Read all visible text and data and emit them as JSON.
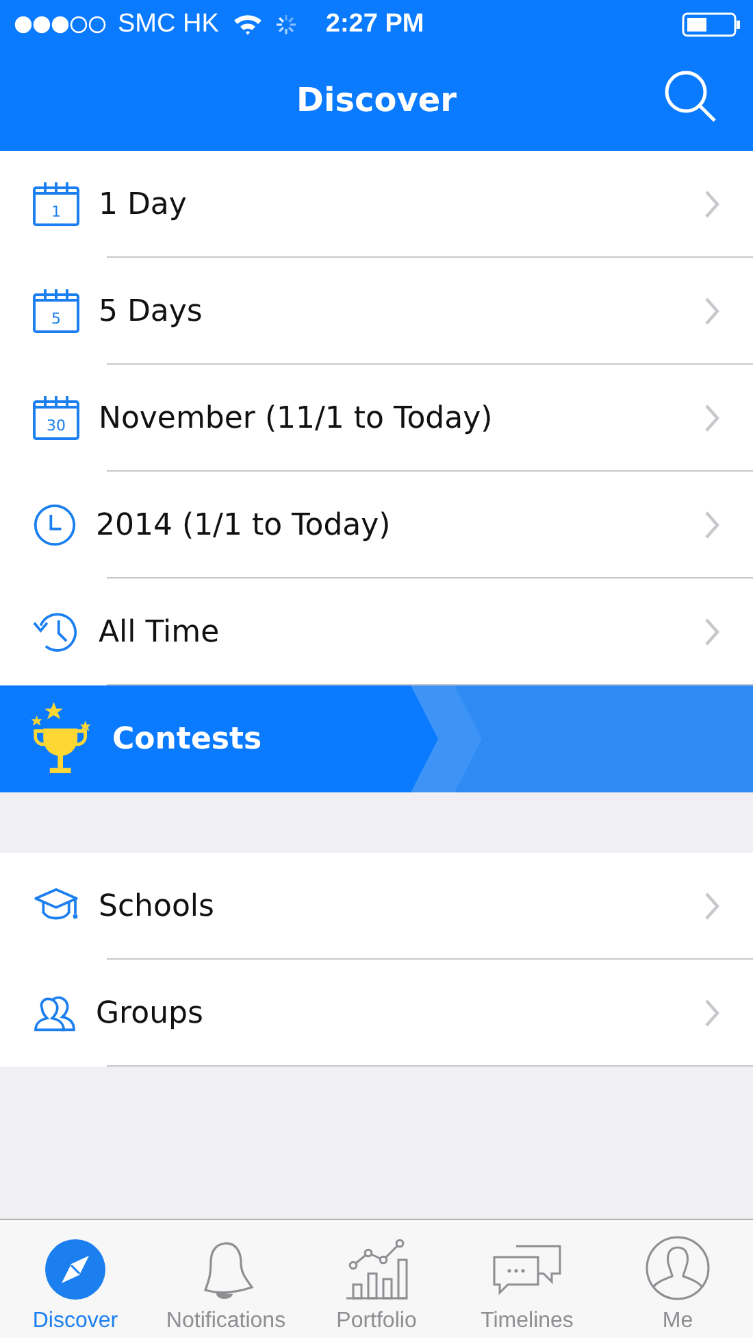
{
  "status_bar": {
    "carrier": "SMC HK",
    "time": "2:27 PM"
  },
  "nav": {
    "title": "Discover"
  },
  "periods": [
    {
      "kind": "calendar",
      "icon_text": "1",
      "label": "1 Day"
    },
    {
      "kind": "calendar",
      "icon_text": "5",
      "label": "5 Days"
    },
    {
      "kind": "calendar",
      "icon_text": "30",
      "label": "November (11/1 to Today)"
    },
    {
      "kind": "clock",
      "label": "2014 (1/1 to Today)"
    },
    {
      "kind": "history",
      "label": "All Time"
    }
  ],
  "banner": {
    "label": "Contests"
  },
  "communities": [
    {
      "kind": "school",
      "label": "Schools"
    },
    {
      "kind": "group",
      "label": "Groups"
    }
  ],
  "tab_bar": [
    {
      "kind": "compass",
      "label": "Discover",
      "selected": true
    },
    {
      "kind": "bell",
      "label": "Notifications",
      "selected": false
    },
    {
      "kind": "chart",
      "label": "Portfolio",
      "selected": false
    },
    {
      "kind": "chat",
      "label": "Timelines",
      "selected": false
    },
    {
      "kind": "person",
      "label": "Me",
      "selected": false
    }
  ]
}
